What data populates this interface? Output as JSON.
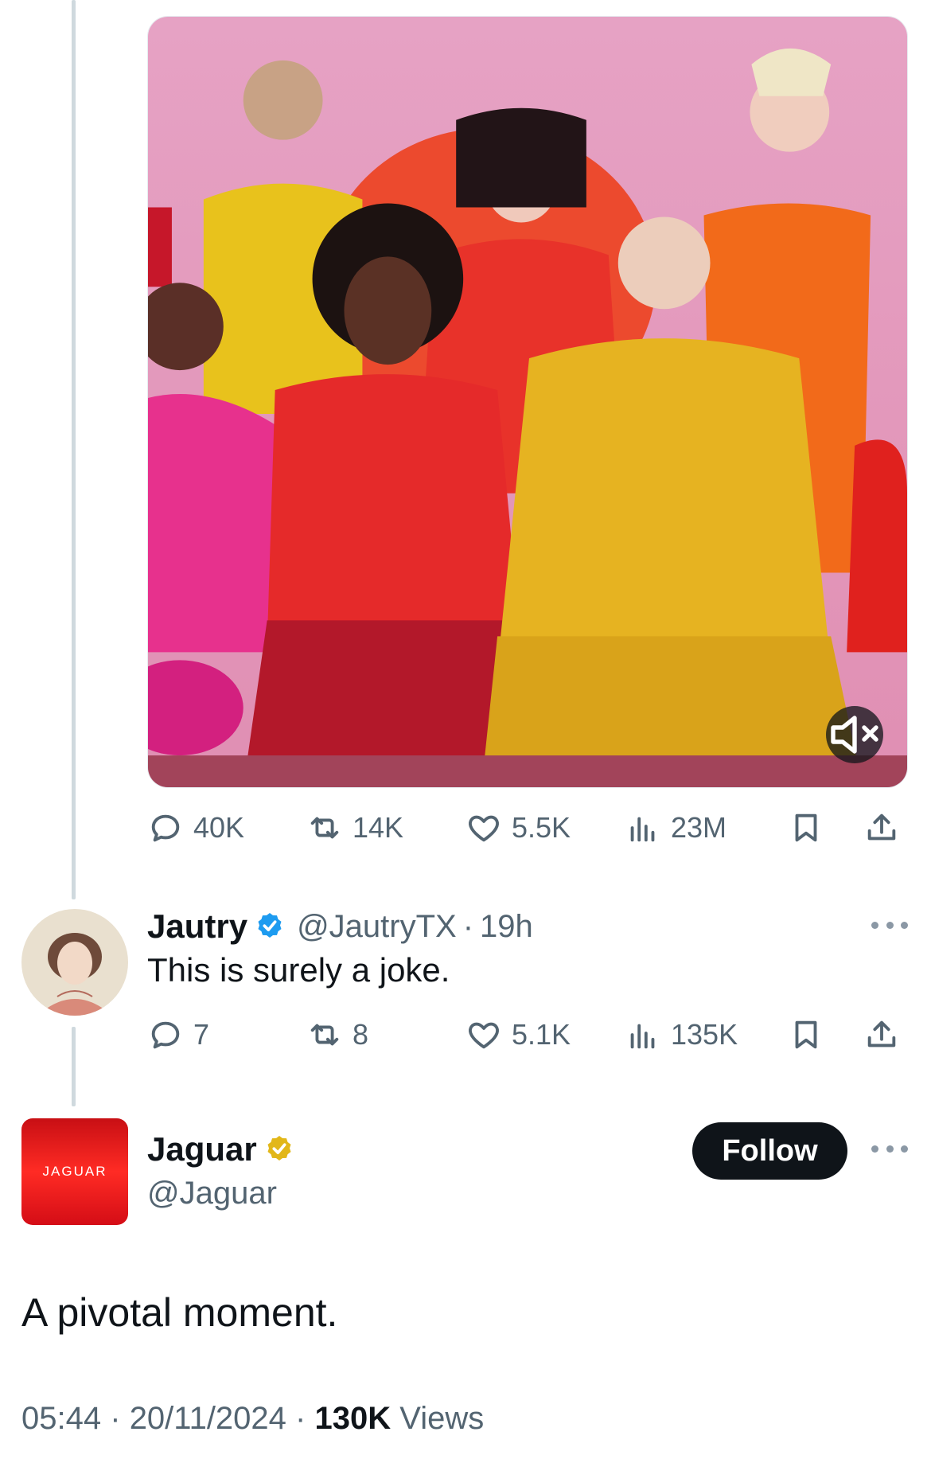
{
  "original_post": {
    "stats": {
      "replies": "40K",
      "reposts": "14K",
      "likes": "5.5K",
      "views": "23M"
    },
    "media": {
      "type": "video",
      "muted_icon": "speaker-muted-icon"
    }
  },
  "reply": {
    "display_name": "Jautry",
    "verified": "blue",
    "handle": "@JautryTX",
    "separator": "·",
    "time": "19h",
    "text": "This is surely a joke.",
    "stats": {
      "replies": "7",
      "reposts": "8",
      "likes": "5.1K",
      "views": "135K"
    }
  },
  "main_post": {
    "display_name": "Jaguar",
    "verified": "gold",
    "handle": "@Jaguar",
    "logo_text": "JAGUAR",
    "follow_label": "Follow",
    "text": "A pivotal moment.",
    "time": "05:44",
    "sep1": "·",
    "date": "20/11/2024",
    "sep2": "·",
    "views_count": "130K",
    "views_label": "Views"
  },
  "colors": {
    "text_primary": "#0f1419",
    "text_secondary": "#536471",
    "verified_blue": "#1d9bf0",
    "verified_gold": "#e2b719",
    "brand_red": "#e4101a"
  }
}
